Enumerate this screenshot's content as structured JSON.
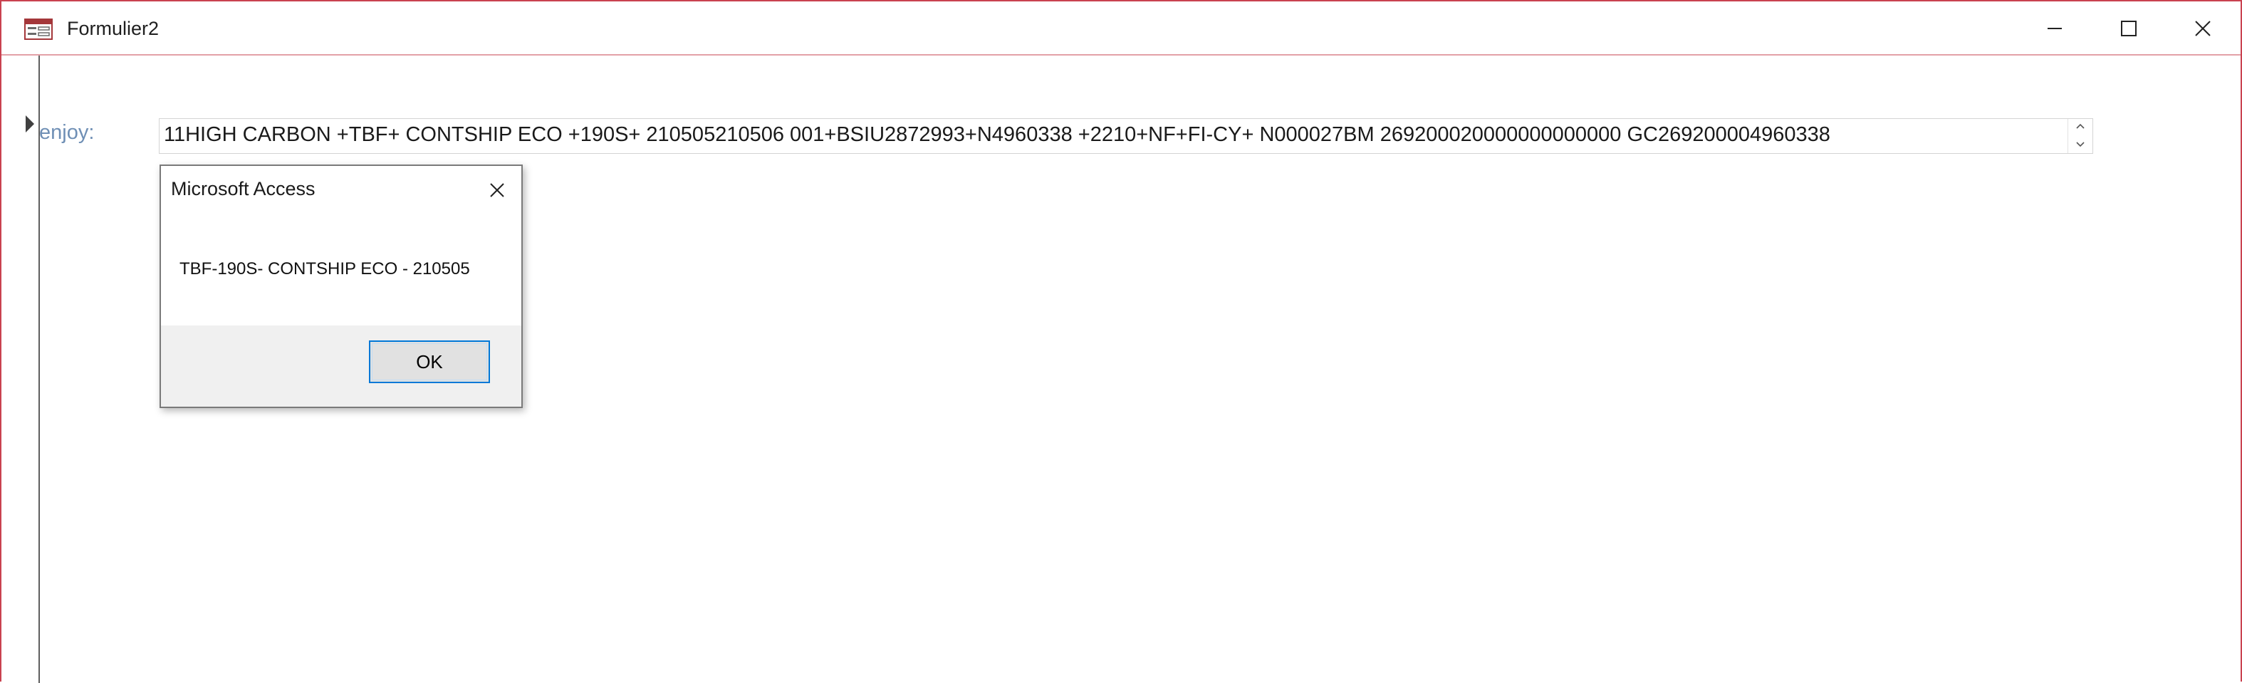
{
  "window": {
    "title": "Formulier2",
    "icon": "access-form-icon"
  },
  "window_controls": {
    "minimize": "minimize-icon",
    "maximize": "maximize-icon",
    "close": "close-icon"
  },
  "form": {
    "field_label": "enjoy:",
    "field_value": "11HIGH CARBON +TBF+ CONTSHIP ECO +190S+ 210505210506 001+BSIU2872993+N4960338 +2210+NF+FI-CY+ N000027BM 269200020000000000000 GC269200004960338"
  },
  "dialog": {
    "title": "Microsoft Access",
    "message": "TBF-190S- CONTSHIP ECO - 210505",
    "ok_label": "OK"
  },
  "colors": {
    "window_border": "#c9414f",
    "label_text": "#6f8fb5",
    "focus_blue": "#0078d7",
    "dialog_footer": "#f0f0f0"
  }
}
